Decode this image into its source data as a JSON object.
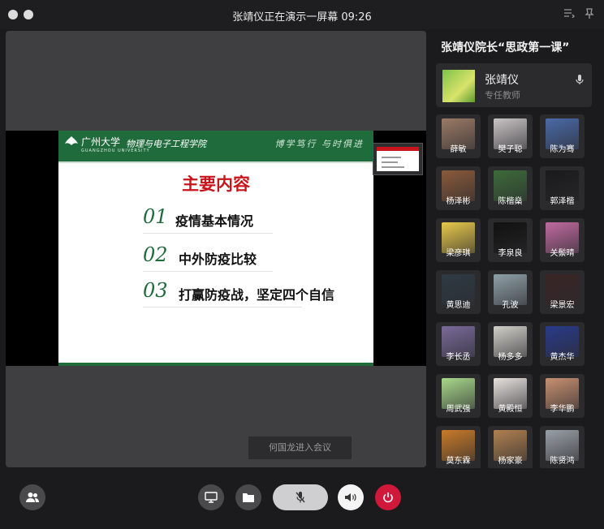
{
  "window": {
    "title": "张靖仪正在演示一屏幕 09:26"
  },
  "slide": {
    "university": "广州大学",
    "university_en": "GUANGZHOU UNIVERSITY",
    "school": "物理与电子工程学院",
    "motto": "博学笃行  与时俱进",
    "title": "主要内容",
    "items": [
      {
        "num": "01",
        "text": "疫情基本情况"
      },
      {
        "num": "02",
        "text": "中外防疫比较"
      },
      {
        "num": "03",
        "text": "打赢防疫战，坚定四个自信"
      }
    ]
  },
  "toast": "何国龙进入会议",
  "sidebar": {
    "meeting_title": "张靖仪院长“思政第一课”",
    "host": {
      "name": "张靖仪",
      "role": "专任教师"
    },
    "participants": [
      {
        "name": "薛敏",
        "color": "#9b7a66"
      },
      {
        "name": "樊子聪",
        "color": "#c9c4c6"
      },
      {
        "name": "陈为骞",
        "color": "#4a6aa8"
      },
      {
        "name": "杨泽彬",
        "color": "#8a5a3a"
      },
      {
        "name": "陈楷燊",
        "color": "#3d6b3a"
      },
      {
        "name": "郭泽楷",
        "color": "#1a1a1c"
      },
      {
        "name": "梁彦琪",
        "color": "#e8c94a"
      },
      {
        "name": "李泉良",
        "color": "#111111"
      },
      {
        "name": "关鬃晴",
        "color": "#c06aa0"
      },
      {
        "name": "黄思迪",
        "color": "#2e3a44"
      },
      {
        "name": "孔波",
        "color": "#8fa0a8"
      },
      {
        "name": "梁景宏",
        "color": "#3a2424"
      },
      {
        "name": "李长丞",
        "color": "#7a6a9a"
      },
      {
        "name": "杨多多",
        "color": "#d0cfc8"
      },
      {
        "name": "黄杰华",
        "color": "#2a3a8a"
      },
      {
        "name": "周武强",
        "color": "#a8d88a"
      },
      {
        "name": "黄殿恒",
        "color": "#e8e2de"
      },
      {
        "name": "李华鹏",
        "color": "#c89070"
      },
      {
        "name": "莫东霖",
        "color": "#c87a2a"
      },
      {
        "name": "杨家豪",
        "color": "#b08050"
      },
      {
        "name": "陈贤鸿",
        "color": "#9aa0a8"
      }
    ]
  },
  "colors": {
    "accent_green": "#1f6b3c",
    "slide_title_red": "#c8141a",
    "leave_red": "#d0183a"
  }
}
